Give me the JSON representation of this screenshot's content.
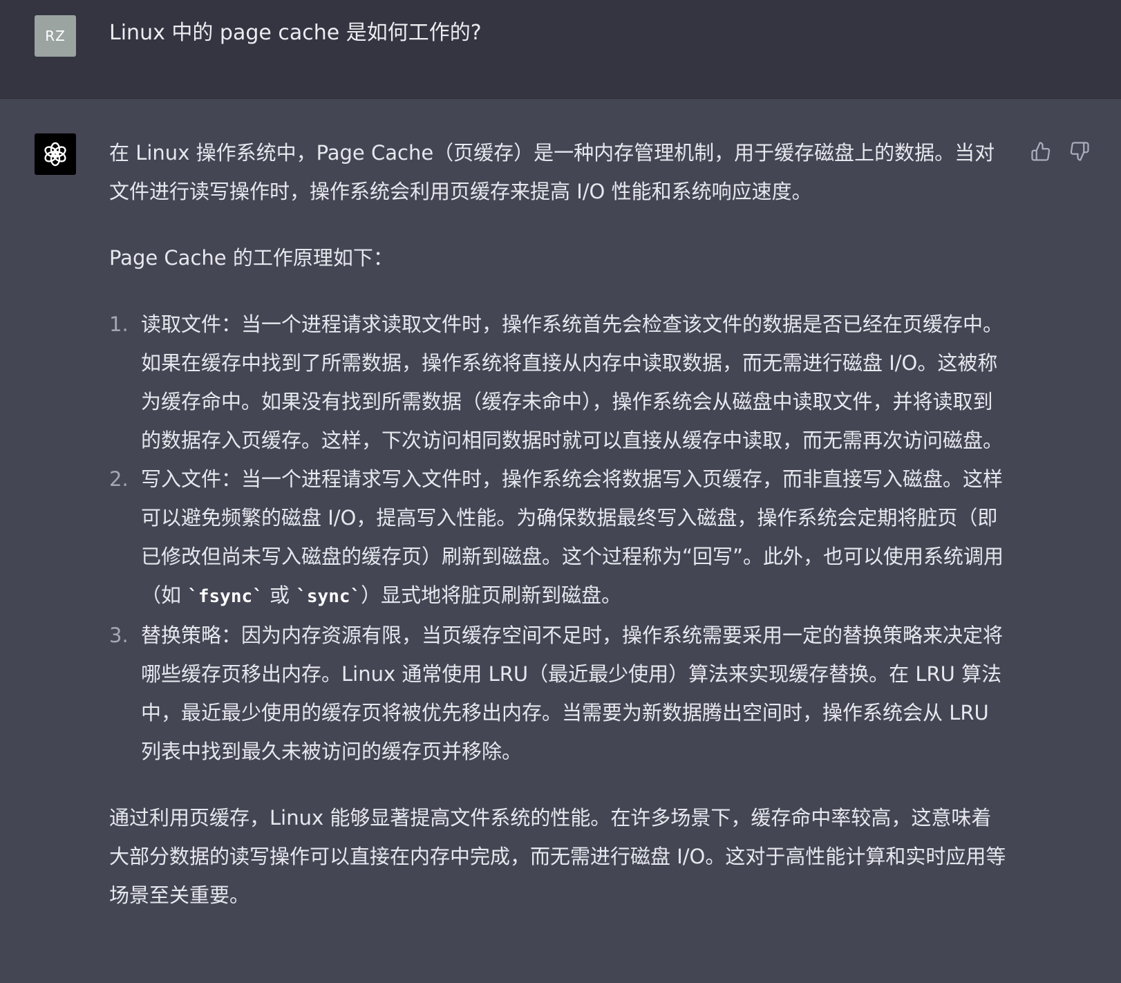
{
  "user": {
    "initials": "RZ",
    "question": "Linux 中的 page cache 是如何工作的?"
  },
  "assistant": {
    "avatar_icon": "openai-logo-icon",
    "intro": "在 Linux 操作系统中，Page Cache（页缓存）是一种内存管理机制，用于缓存磁盘上的数据。当对文件进行读写操作时，操作系统会利用页缓存来提高 I/O 性能和系统响应速度。",
    "lead": "Page Cache 的工作原理如下：",
    "steps": [
      {
        "num": "1.",
        "text": "读取文件：当一个进程请求读取文件时，操作系统首先会检查该文件的数据是否已经在页缓存中。如果在缓存中找到了所需数据，操作系统将直接从内存中读取数据，而无需进行磁盘 I/O。这被称为缓存命中。如果没有找到所需数据（缓存未命中），操作系统会从磁盘中读取文件，并将读取到的数据存入页缓存。这样，下次访问相同数据时就可以直接从缓存中读取，而无需再次访问磁盘。"
      },
      {
        "num": "2.",
        "text_a": "写入文件：当一个进程请求写入文件时，操作系统会将数据写入页缓存，而非直接写入磁盘。这样可以避免频繁的磁盘 I/O，提高写入性能。为确保数据最终写入磁盘，操作系统会定期将脏页（即已修改但尚未写入磁盘的缓存页）刷新到磁盘。这个过程称为“回写”。此外，也可以使用系统调用（如 ",
        "code_1": "`fsync`",
        "text_b": " 或 ",
        "code_2": "`sync`",
        "text_c": "）显式地将脏页刷新到磁盘。"
      },
      {
        "num": "3.",
        "text": "替换策略：因为内存资源有限，当页缓存空间不足时，操作系统需要采用一定的替换策略来决定将哪些缓存页移出内存。Linux 通常使用 LRU（最近最少使用）算法来实现缓存替换。在 LRU 算法中，最近最少使用的缓存页将被优先移出内存。当需要为新数据腾出空间时，操作系统会从 LRU 列表中找到最久未被访问的缓存页并移除。"
      }
    ],
    "conclusion": "通过利用页缓存，Linux 能够显著提高文件系统的性能。在许多场景下，缓存命中率较高，这意味着大部分数据的读写操作可以直接在内存中完成，而无需进行磁盘 I/O。这对于高性能计算和实时应用等场景至关重要。"
  },
  "feedback": {
    "thumb_up_icon": "thumbs-up-icon",
    "thumb_down_icon": "thumbs-down-icon"
  },
  "colors": {
    "user_bg": "#343541",
    "assistant_bg": "#444654",
    "text": "#ECECF1",
    "user_avatar_bg": "#9BA4A1"
  }
}
